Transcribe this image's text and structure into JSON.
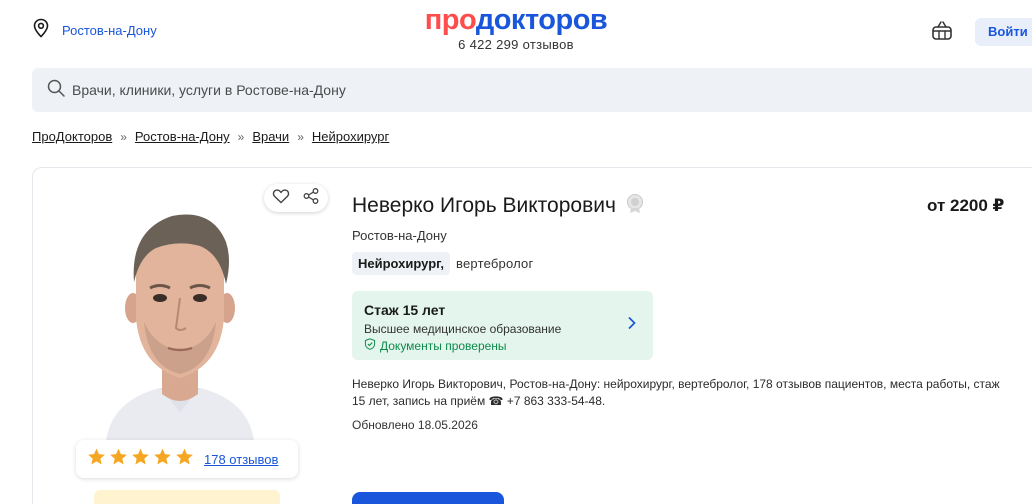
{
  "header": {
    "city": "Ростов-на-Дону",
    "logo_part1": "про",
    "logo_part2": "докторов",
    "reviews_count": "6 422 299 отзывов",
    "login_label": "Войти"
  },
  "search": {
    "placeholder": "Врачи, клиники, услуги в Ростове-на-Дону"
  },
  "breadcrumbs": [
    "ПроДокторов",
    "Ростов-на-Дону",
    "Врачи",
    "Нейрохирург"
  ],
  "breadcrumb_separator": "»",
  "doctor": {
    "name": "Неверко Игорь Викторович",
    "price": "от 2200 ₽",
    "city": "Ростов-на-Дону",
    "specialty_main": "Нейрохирург,",
    "specialty_second": "вертебролог",
    "experience": {
      "title": "Стаж 15 лет",
      "education": "Высшее медицинское образование",
      "documents": "Документы проверены"
    },
    "description": "Неверко Игорь Викторович, Ростов-на-Дону: нейрохирург, вертебролог, 178 отзывов пациентов, места работы, стаж 15 лет, запись на приём ☎ +7 863 333-54-48.",
    "updated": "Обновлено 18.05.2026",
    "rating_stars": 5,
    "reviews_link": "178 отзывов"
  },
  "colors": {
    "brand_blue": "#1a56db",
    "brand_red": "#ff4d4d",
    "star": "#f5a623",
    "verified_green": "#0e8a4b"
  }
}
